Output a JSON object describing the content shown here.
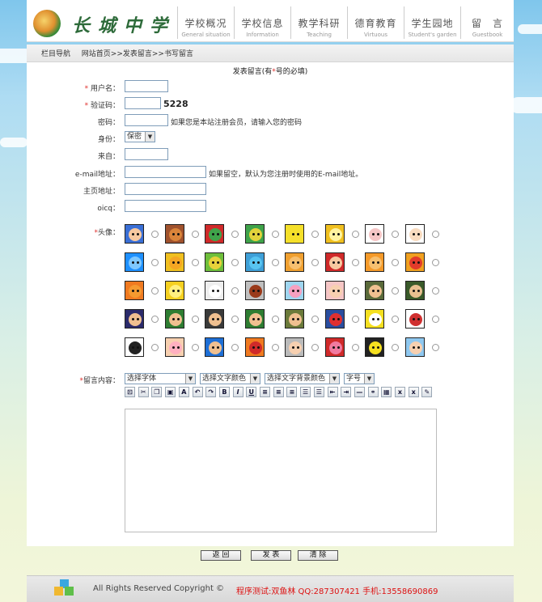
{
  "header": {
    "school_name": "长城中学",
    "nav": [
      {
        "cn": "学校概况",
        "en": "General situation"
      },
      {
        "cn": "学校信息",
        "en": "Information"
      },
      {
        "cn": "教学科研",
        "en": "Teaching"
      },
      {
        "cn": "德育教育",
        "en": "Virtuous"
      },
      {
        "cn": "学生园地",
        "en": "Student's garden"
      },
      {
        "cn": "留　言",
        "en": "Guestbook"
      }
    ]
  },
  "breadcrumb": {
    "label": "栏目导航",
    "home": "网站首页",
    "sep": ">>",
    "section": "发表留言",
    "current": "书写留言"
  },
  "form": {
    "title_prefix": "发表留言(有",
    "title_star": "*",
    "title_suffix": "号的必填)",
    "username_label": "用户名：",
    "captcha_label": "验证码：",
    "captcha_code": "5228",
    "password_label": "密码：",
    "password_note": "如果您是本站注册会员，请输入您的密码",
    "identity_label": "身份：",
    "identity_value": "保密",
    "from_label": "来自：",
    "email_label": "e-mail地址：",
    "email_note": "如果留空，默认为您注册时使用的E-mail地址。",
    "homepage_label": "主页地址：",
    "oicq_label": "oicq：",
    "avatar_label": "头像：",
    "content_label": "留言内容：",
    "font_select": "选择字体",
    "color_select": "选择文字颜色",
    "bgcolor_select": "选择文字背景颜色",
    "size_select": "字号",
    "required_mark": "*"
  },
  "toolbar": {
    "bold": "B",
    "italic": "I",
    "underline": "U"
  },
  "buttons": {
    "back": "返 回",
    "submit": "发 表",
    "clear": "清 除"
  },
  "footer": {
    "copyright": "All Rights Reserved Copyright ©",
    "contact": "程序测试:双鱼林  QQ:287307421  手机:13558690869"
  },
  "colors": {
    "accent_red": "#e0302d",
    "logo_green": "#2e6b3a"
  }
}
